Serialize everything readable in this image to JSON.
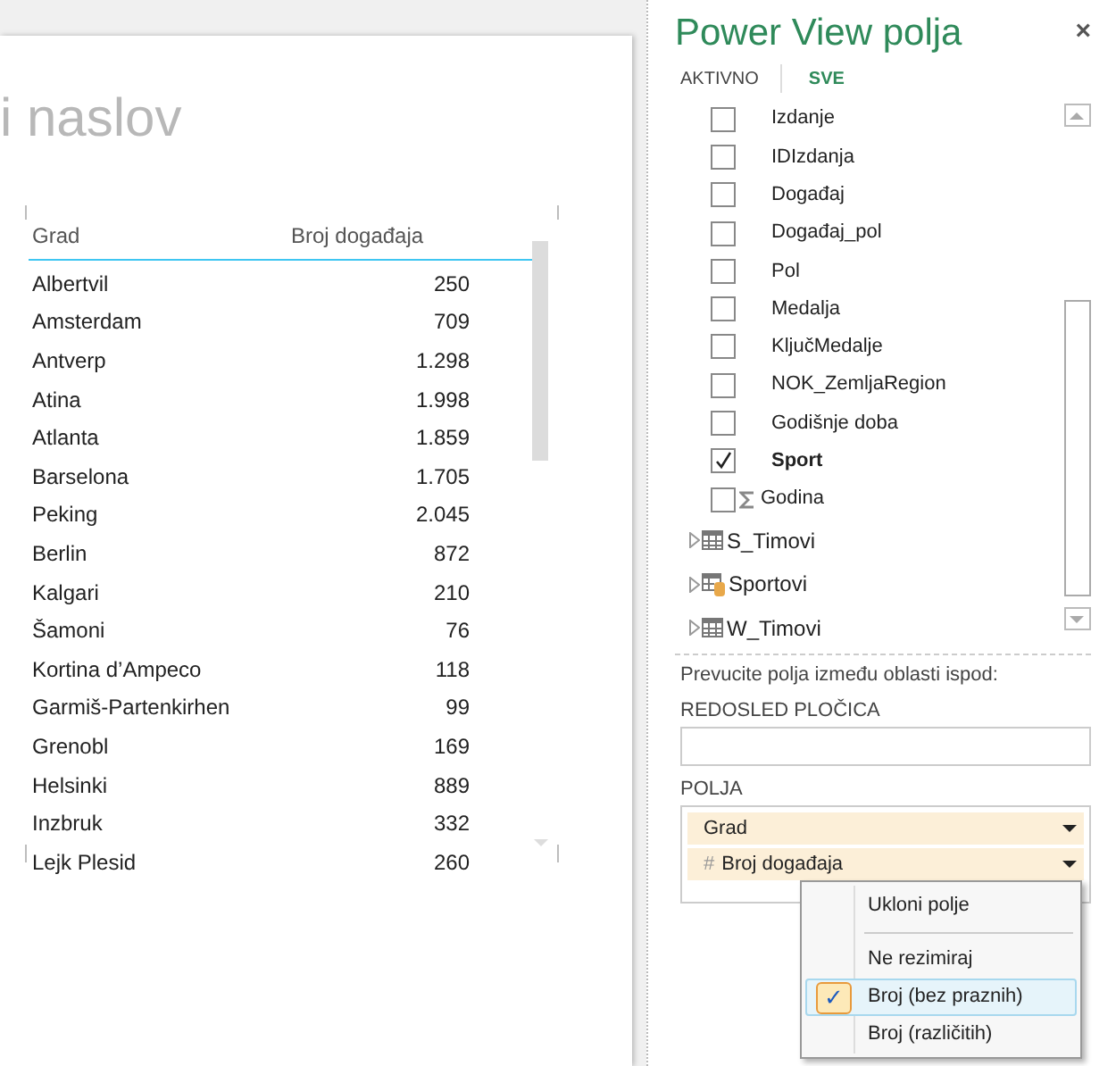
{
  "canvas": {
    "title": "i naslov",
    "table": {
      "columns": [
        "Grad",
        "Broj događaja"
      ],
      "rows": [
        [
          "Albertvil",
          "250"
        ],
        [
          "Amsterdam",
          "709"
        ],
        [
          "Antverp",
          "1.298"
        ],
        [
          "Atina",
          "1.998"
        ],
        [
          "Atlanta",
          "1.859"
        ],
        [
          "Barselona",
          "1.705"
        ],
        [
          "Peking",
          "2.045"
        ],
        [
          "Berlin",
          "872"
        ],
        [
          "Kalgari",
          "210"
        ],
        [
          "Šamoni",
          "76"
        ],
        [
          "Kortina d’Ampeco",
          "118"
        ],
        [
          "Garmiš-Partenkirhen",
          "99"
        ],
        [
          "Grenobl",
          "169"
        ],
        [
          "Helsinki",
          "889"
        ],
        [
          "Inzbruk",
          "332"
        ],
        [
          "Lejk Plesid",
          "260"
        ]
      ]
    }
  },
  "panel": {
    "title": "Power View polja",
    "close": "×",
    "tabs": [
      {
        "label": "AKTIVNO",
        "selected": false
      },
      {
        "label": "SVE",
        "selected": true
      }
    ],
    "fields": [
      {
        "label": "Izdanje",
        "checked": false,
        "kind": "text"
      },
      {
        "label": "IDIzdanja",
        "checked": false,
        "kind": "text"
      },
      {
        "label": "Događaj",
        "checked": false,
        "kind": "text"
      },
      {
        "label": "Događaj_pol",
        "checked": false,
        "kind": "text"
      },
      {
        "label": "Pol",
        "checked": false,
        "kind": "text"
      },
      {
        "label": "Medalja",
        "checked": false,
        "kind": "text"
      },
      {
        "label": "KljučMedalje",
        "checked": false,
        "kind": "text"
      },
      {
        "label": "NOK_ZemljaRegion",
        "checked": false,
        "kind": "text"
      },
      {
        "label": "Godišnje doba",
        "checked": false,
        "kind": "text"
      },
      {
        "label": "Sport",
        "checked": true,
        "kind": "text"
      },
      {
        "label": "Godina",
        "checked": false,
        "kind": "sum"
      }
    ],
    "tables": [
      {
        "label": "S_Timovi",
        "kind": "table"
      },
      {
        "label": "Sportovi",
        "kind": "linked"
      },
      {
        "label": "W_Timovi",
        "kind": "table"
      }
    ],
    "hint": "Prevucite polja između oblasti ispod:",
    "tile_order": {
      "label": "REDOSLED PLOČICA"
    },
    "fields_area": {
      "label": "POLJA",
      "items": [
        {
          "label": "Grad",
          "kind": "text"
        },
        {
          "label": "Broj događaja",
          "kind": "number",
          "prefix": "#"
        }
      ]
    }
  },
  "context_menu": {
    "items": [
      {
        "kind": "item",
        "label": "Ukloni polje",
        "checked": false
      },
      {
        "kind": "separator"
      },
      {
        "kind": "item",
        "label": "Ne rezimiraj",
        "checked": false
      },
      {
        "kind": "item",
        "label": "Broj (bez praznih)",
        "checked": true,
        "mark": "✓"
      },
      {
        "kind": "item",
        "label": "Broj (različitih)",
        "checked": false
      }
    ]
  }
}
